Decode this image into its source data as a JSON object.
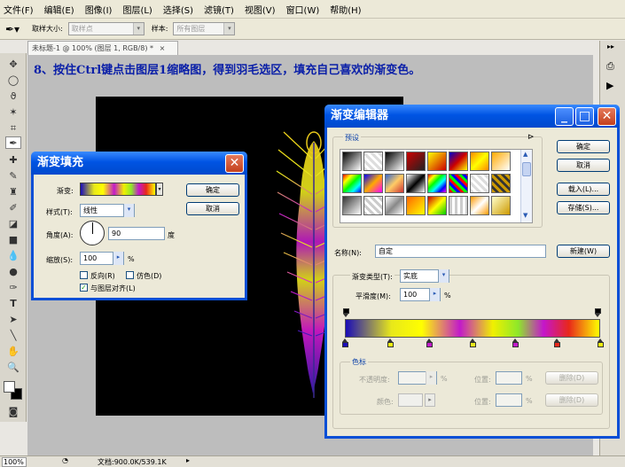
{
  "menu": [
    "文件(F)",
    "编辑(E)",
    "图像(I)",
    "图层(L)",
    "选择(S)",
    "滤镜(T)",
    "视图(V)",
    "窗口(W)",
    "帮助(H)"
  ],
  "options": {
    "sample_size_label": "取样大小:",
    "sample_size_value": "取样点",
    "sample_label": "样本:",
    "sample_value": "所有图层"
  },
  "document": {
    "tab_title": "未标题-1 @ 100% (图层 1, RGB/8) *",
    "tab_close": "×",
    "zoom": "100%",
    "doc_size": "文档:900.0K/539.1K"
  },
  "caption": "8、按住Ctrl键点击图层1缩略图，得到羽毛选区，填充自己喜欢的渐变色。",
  "gradient_fill": {
    "title": "渐变填充",
    "gradient_label": "渐变:",
    "style_label": "样式(T):",
    "style_value": "线性",
    "angle_label": "角度(A):",
    "angle_value": "90",
    "angle_unit": "度",
    "scale_label": "缩放(S):",
    "scale_value": "100",
    "scale_unit": "%",
    "reverse_label": "反向(R)",
    "dither_label": "仿色(D)",
    "align_label": "与图层对齐(L)",
    "ok": "确定",
    "cancel": "取消"
  },
  "gradient_editor": {
    "title": "渐变编辑器",
    "presets_label": "预设",
    "ok": "确定",
    "cancel": "取消",
    "load": "载入(L)...",
    "save": "存储(S)...",
    "name_label": "名称(N):",
    "name_value": "自定",
    "new": "新建(W)",
    "type_label": "渐变类型(T):",
    "type_value": "实底",
    "smooth_label": "平滑度(M):",
    "smooth_value": "100",
    "smooth_unit": "%",
    "stops_group": "色标",
    "opacity_label": "不透明度:",
    "opacity_unit": "%",
    "position_label": "位置:",
    "position_unit": "%",
    "delete_label": "删除(D)",
    "color_label": "颜色:",
    "stop_colors": [
      "#1a0cb8",
      "#f2f20f",
      "#c21aca",
      "#e8e81a",
      "#c21aca",
      "#e8281a",
      "#f2f20f"
    ],
    "stop_positions_pct": [
      0,
      18,
      33,
      50,
      67,
      83,
      100
    ]
  }
}
